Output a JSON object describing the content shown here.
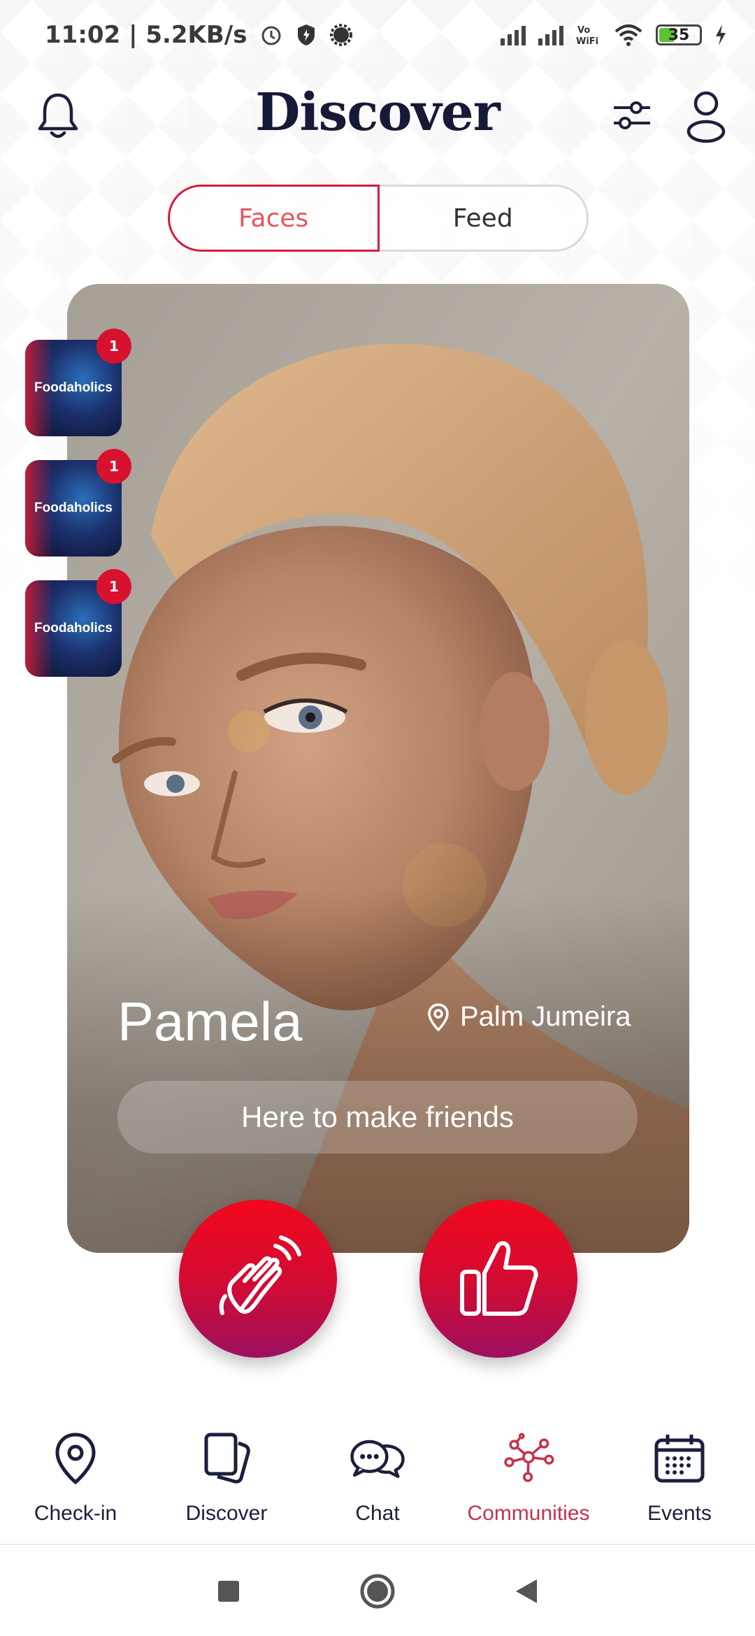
{
  "status_bar": {
    "time_speed": "11:02 | 5.2KB/s",
    "battery": "35"
  },
  "header": {
    "title": "Discover"
  },
  "tabs": [
    {
      "label": "Faces",
      "active": true
    },
    {
      "label": "Feed",
      "active": false
    }
  ],
  "profile": {
    "name": "Pamela",
    "location": "Palm Jumeira",
    "intent": "Here to make friends"
  },
  "communities": [
    {
      "label": "Foodaholics",
      "count": "1"
    },
    {
      "label": "Foodaholics",
      "count": "1"
    },
    {
      "label": "Foodaholics",
      "count": "1"
    }
  ],
  "bottom_nav": [
    {
      "label": "Check-in",
      "icon": "map-pin-icon"
    },
    {
      "label": "Discover",
      "icon": "cards-icon"
    },
    {
      "label": "Chat",
      "icon": "chat-bubbles-icon"
    },
    {
      "label": "Communities",
      "icon": "network-icon",
      "active": true
    },
    {
      "label": "Events",
      "icon": "calendar-icon"
    }
  ],
  "colors": {
    "accent": "#d61a3c",
    "active_nav": "#c2344f",
    "text_dark": "#161a37"
  }
}
